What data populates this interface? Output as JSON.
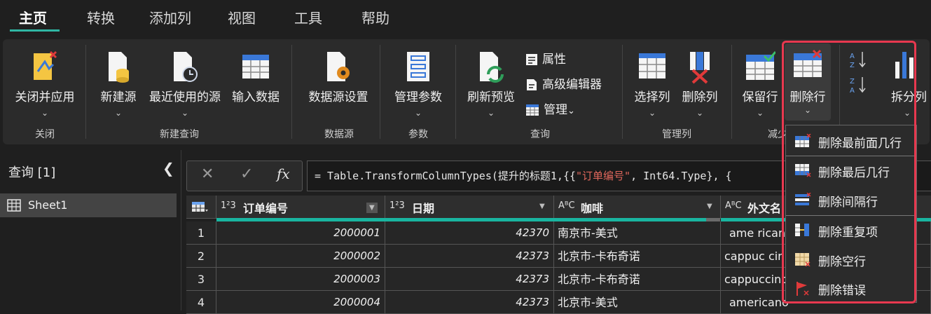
{
  "tabs": [
    "主页",
    "转换",
    "添加列",
    "视图",
    "工具",
    "帮助"
  ],
  "ribbon": {
    "close_apply": "关闭并应用",
    "group_close": "关闭",
    "new_source": "新建源",
    "recent_sources": "最近使用的源",
    "enter_data": "输入数据",
    "group_new_query": "新建查询",
    "data_source_settings": "数据源设置",
    "group_data_sources": "数据源",
    "manage_params": "管理参数",
    "group_params": "参数",
    "refresh_preview": "刷新预览",
    "properties": "属性",
    "advanced_editor": "高级编辑器",
    "manage": "管理",
    "group_query": "查询",
    "choose_columns": "选择列",
    "remove_columns": "删除列",
    "group_manage_columns": "管理列",
    "keep_rows": "保留行",
    "remove_rows": "删除行",
    "group_reduce_rows": "减少",
    "split_column": "拆分列",
    "chevron": "⌄"
  },
  "queries": {
    "title": "查询 [1]",
    "collapse": "❮",
    "item": "Sheet1"
  },
  "formula": {
    "cancel": "✕",
    "confirm": "✓",
    "fx": "fx",
    "text_eq": "= Table.TransformColumnTypes(提升的标题1,{{",
    "text_str": "\"订单编号\"",
    "text_rest": ", Int64.Type}, {"
  },
  "grid": {
    "columns": [
      {
        "type": "1²3",
        "name": "订单编号"
      },
      {
        "type": "1²3",
        "name": "日期"
      },
      {
        "type": "AᴮC",
        "name": "咖啡"
      },
      {
        "type": "AᴮC",
        "name": "外文名"
      }
    ],
    "rows": [
      {
        "n": "1",
        "id": "2000001",
        "date": "42370",
        "coffee": "南京市-美式",
        "foreign": "ame ricano"
      },
      {
        "n": "2",
        "id": "2000002",
        "date": "42373",
        "coffee": "北京市-卡布奇诺",
        "foreign": "cappuc cino"
      },
      {
        "n": "3",
        "id": "2000003",
        "date": "42373",
        "coffee": "北京市-卡布奇诺",
        "foreign": "cappuccino"
      },
      {
        "n": "4",
        "id": "2000004",
        "date": "42373",
        "coffee": "北京市-美式",
        "foreign": "americano"
      }
    ]
  },
  "dropdown": [
    "删除最前面几行",
    "删除最后几行",
    "删除间隔行",
    "删除重复项",
    "删除空行",
    "删除错误"
  ],
  "colors": {
    "accent": "#2fb7a4",
    "highlight": "#e8384f"
  }
}
